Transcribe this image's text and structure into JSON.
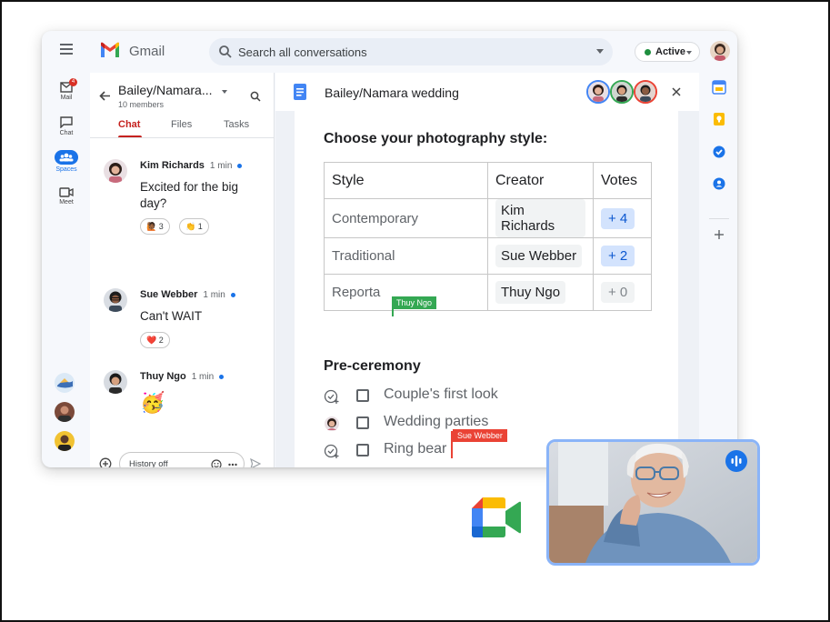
{
  "app": {
    "name": "Gmail",
    "search_placeholder": "Search all conversations",
    "status_label": "Active"
  },
  "left_rail": {
    "items": [
      {
        "label": "Mail",
        "badge": "4"
      },
      {
        "label": "Chat"
      },
      {
        "label": "Spaces"
      },
      {
        "label": "Meet"
      }
    ]
  },
  "chat_panel": {
    "title": "Bailey/Namara...",
    "subtitle": "10 members",
    "tabs": [
      "Chat",
      "Files",
      "Tasks"
    ],
    "messages": [
      {
        "name": "Kim Richards",
        "time": "1 min",
        "text": "Excited for the big day?",
        "reactions": [
          {
            "emoji": "🙋🏾",
            "count": "3"
          },
          {
            "emoji": "👏",
            "count": "1"
          }
        ]
      },
      {
        "name": "Sue Webber",
        "time": "1 min",
        "text": "Can't WAIT",
        "reactions": [
          {
            "emoji": "❤️",
            "count": "2"
          }
        ]
      },
      {
        "name": "Thuy Ngo",
        "time": "1 min",
        "text": "🥳"
      }
    ],
    "compose_placeholder": "History off"
  },
  "doc": {
    "title": "Bailey/Namara wedding",
    "section1_title": "Choose your photography style:",
    "table": {
      "headers": [
        "Style",
        "Creator",
        "Votes"
      ],
      "rows": [
        {
          "style": "Contemporary",
          "creator": "Kim Richards",
          "votes": "+ 4",
          "voted": true
        },
        {
          "style": "Traditional",
          "creator": "Sue Webber",
          "votes": "+ 2",
          "voted": true
        },
        {
          "style": "Reporta",
          "creator": "Thuy Ngo",
          "votes": "+ 0",
          "voted": false
        }
      ]
    },
    "cursor_thuy": "Thuy Ngo",
    "section2_title": "Pre-ceremony",
    "checklist": [
      "Couple's first look",
      "Wedding parties",
      "Ring bear"
    ],
    "cursor_sue": "Sue Webber"
  },
  "colors": {
    "accent_red": "#c5221f",
    "accent_blue": "#1a73e8",
    "cursor_green": "#34a853",
    "cursor_red": "#ea4335",
    "video_border": "#8ab4f8"
  }
}
